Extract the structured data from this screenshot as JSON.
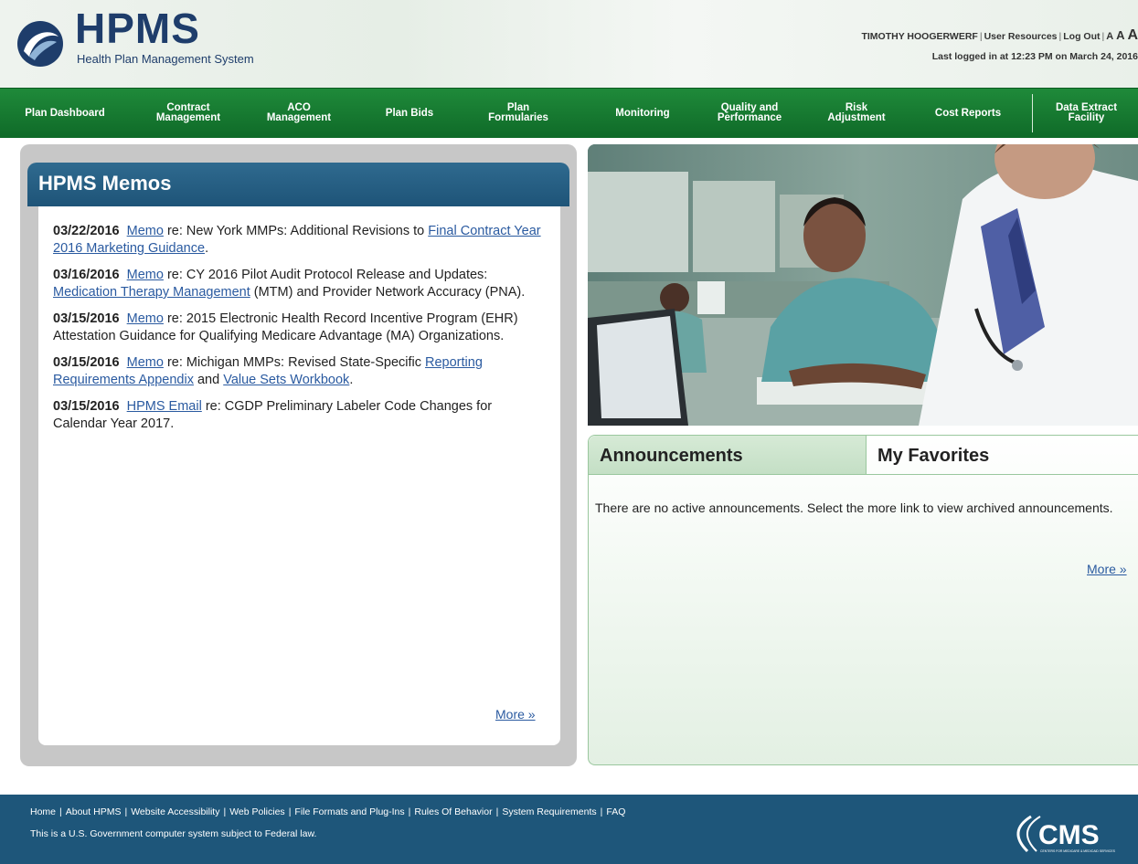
{
  "header": {
    "logo_title": "HPMS",
    "logo_subtitle": "Health Plan Management System",
    "user_name": "TIMOTHY HOOGERWERF",
    "user_resources": "User Resources",
    "log_out": "Log Out",
    "text_size_small": "A",
    "text_size_medium": "A",
    "text_size_large": "A",
    "last_login": "Last logged in at 12:23 PM on March 24, 2016"
  },
  "nav": [
    {
      "label": "Plan Dashboard"
    },
    {
      "label": "Contract\nManagement"
    },
    {
      "label": "ACO\nManagement"
    },
    {
      "label": "Plan Bids"
    },
    {
      "label": "Plan\nFormularies"
    },
    {
      "label": "Monitoring"
    },
    {
      "label": "Quality and\nPerformance"
    },
    {
      "label": "Risk\nAdjustment"
    },
    {
      "label": "Cost Reports"
    },
    {
      "label": "Data Extract\nFacility"
    }
  ],
  "memos": {
    "title": "HPMS Memos",
    "more": "More »",
    "items": [
      {
        "date": "03/22/2016",
        "link1": "Memo",
        "text1": " re: New York MMPs: Additional Revisions to ",
        "link2": "Final Contract Year 2016 Marketing Guidance",
        "text2": "."
      },
      {
        "date": "03/16/2016",
        "link1": "Memo",
        "text1": " re: CY 2016 Pilot Audit Protocol Release and Updates: ",
        "link2": "Medication Therapy Management",
        "text2": " (MTM) and Provider Network Accuracy (PNA)."
      },
      {
        "date": "03/15/2016",
        "link1": "Memo",
        "text1": " re: 2015 Electronic Health Record Incentive Program (EHR) Attestation Guidance for Qualifying Medicare Advantage (MA) Organizations.",
        "link2": "",
        "text2": ""
      },
      {
        "date": "03/15/2016",
        "link1": "Memo",
        "text1": " re: Michigan MMPs: Revised State-Specific ",
        "link2": "Reporting Requirements Appendix",
        "text2": " and ",
        "link3": "Value Sets Workbook",
        "text3": "."
      },
      {
        "date": "03/15/2016",
        "link1": "HPMS Email",
        "text1": " re: CGDP Preliminary Labeler Code Changes for Calendar Year 2017.",
        "link2": "",
        "text2": ""
      }
    ]
  },
  "tabs": {
    "announcements": "Announcements",
    "favorites": "My Favorites"
  },
  "announcements": {
    "text": "There are no active announcements. Select the more link to view archived announcements.",
    "more": "More »"
  },
  "footer": {
    "links": [
      "Home",
      "About HPMS",
      "Website Accessibility",
      "Web Policies",
      "File Formats and Plug-Ins",
      "Rules Of Behavior",
      "System Requirements",
      "FAQ"
    ],
    "separator": "|",
    "note": "This is a U.S. Government computer system subject to Federal law.",
    "cms_logo": "CMS",
    "cms_tagline": "CENTERS FOR MEDICARE & MEDICAID SERVICES"
  },
  "colors": {
    "brand_blue": "#1e3d6b",
    "nav_green": "#1a7d34",
    "memo_header": "#2a6287",
    "footer_blue": "#1e567a",
    "link": "#2a5aa0"
  }
}
